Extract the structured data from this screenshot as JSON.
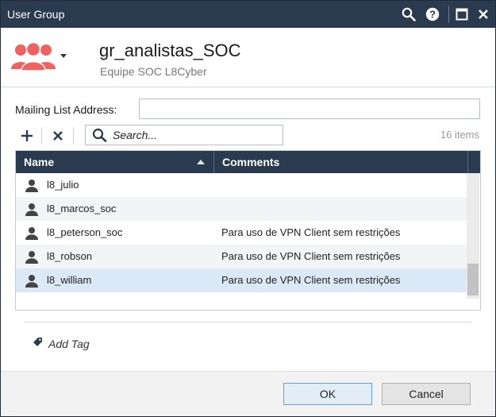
{
  "window": {
    "title": "User Group",
    "controls": [
      "search-icon",
      "help-icon",
      "maximize-icon",
      "close-icon"
    ]
  },
  "header": {
    "group_name": "gr_analistas_SOC",
    "description": "Equipe SOC L8Cyber",
    "icon": "user-group-icon",
    "icon_color": "#f06262"
  },
  "form": {
    "mailing_label": "Mailing List Address:",
    "mailing_value": ""
  },
  "toolbar": {
    "add_icon": "plus-icon",
    "remove_icon": "x-icon",
    "search_placeholder": "Search...",
    "item_count": "16 items"
  },
  "table": {
    "columns": [
      "Name",
      "Comments"
    ],
    "sort": "Name ascending",
    "rows": [
      {
        "name": "l8_julio",
        "comment": ""
      },
      {
        "name": "l8_marcos_soc",
        "comment": ""
      },
      {
        "name": "l8_peterson_soc",
        "comment": "Para uso de VPN Client sem restrições"
      },
      {
        "name": "l8_robson",
        "comment": "Para uso de VPN Client sem restrições"
      },
      {
        "name": "l8_william",
        "comment": "Para uso de VPN Client sem restrições",
        "selected": true
      }
    ]
  },
  "tags": {
    "add_label": "Add Tag"
  },
  "footer": {
    "ok_label": "OK",
    "cancel_label": "Cancel"
  },
  "colors": {
    "titlebar": "#2a3b4f",
    "selected_row": "#dbe8f5",
    "accent": "#f06262"
  }
}
